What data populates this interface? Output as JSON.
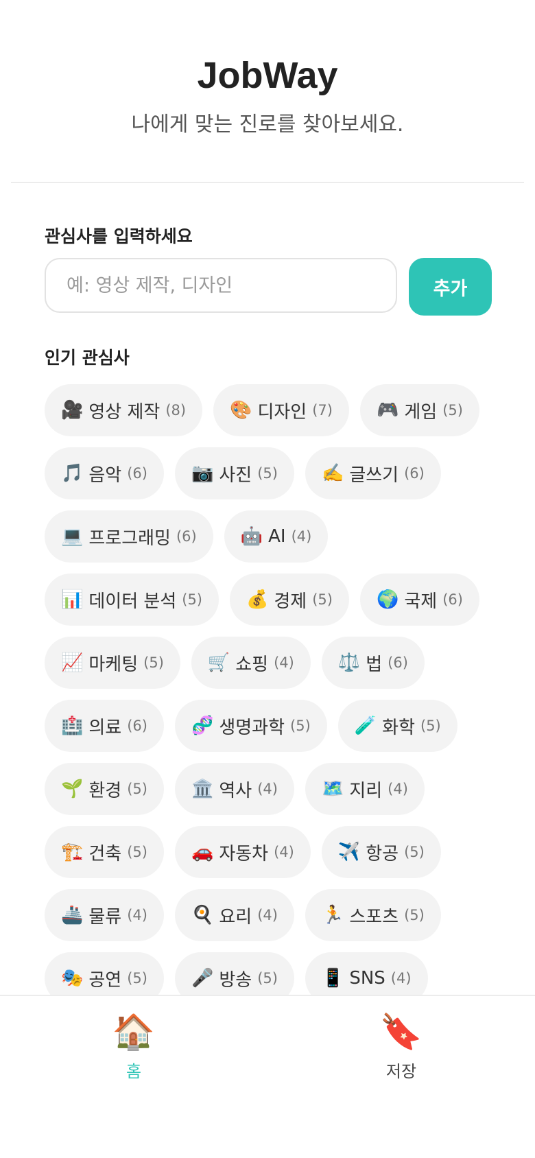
{
  "header": {
    "title": "JobWay",
    "subtitle": "나에게 맞는 진로를 찾아보세요."
  },
  "interest_input": {
    "label": "관심사를 입력하세요",
    "placeholder": "예: 영상 제작, 디자인",
    "value": "",
    "add_label": "추가"
  },
  "popular": {
    "label": "인기 관심사",
    "tags": [
      {
        "icon": "🎥",
        "name": "영상 제작",
        "count": "(8)"
      },
      {
        "icon": "🎨",
        "name": "디자인",
        "count": "(7)"
      },
      {
        "icon": "🎮",
        "name": "게임",
        "count": "(5)"
      },
      {
        "icon": "🎵",
        "name": "음악",
        "count": "(6)"
      },
      {
        "icon": "📷",
        "name": "사진",
        "count": "(5)"
      },
      {
        "icon": "✍️",
        "name": "글쓰기",
        "count": "(6)"
      },
      {
        "icon": "💻",
        "name": "프로그래밍",
        "count": "(6)"
      },
      {
        "icon": "🤖",
        "name": "AI",
        "count": "(4)"
      },
      {
        "icon": "📊",
        "name": "데이터 분석",
        "count": "(5)"
      },
      {
        "icon": "💰",
        "name": "경제",
        "count": "(5)"
      },
      {
        "icon": "🌍",
        "name": "국제",
        "count": "(6)"
      },
      {
        "icon": "📈",
        "name": "마케팅",
        "count": "(5)"
      },
      {
        "icon": "🛒",
        "name": "쇼핑",
        "count": "(4)"
      },
      {
        "icon": "⚖️",
        "name": "법",
        "count": "(6)"
      },
      {
        "icon": "🏥",
        "name": "의료",
        "count": "(6)"
      },
      {
        "icon": "🧬",
        "name": "생명과학",
        "count": "(5)"
      },
      {
        "icon": "🧪",
        "name": "화학",
        "count": "(5)"
      },
      {
        "icon": "🌱",
        "name": "환경",
        "count": "(5)"
      },
      {
        "icon": "🏛️",
        "name": "역사",
        "count": "(4)"
      },
      {
        "icon": "🗺️",
        "name": "지리",
        "count": "(4)"
      },
      {
        "icon": "🏗️",
        "name": "건축",
        "count": "(5)"
      },
      {
        "icon": "🚗",
        "name": "자동차",
        "count": "(4)"
      },
      {
        "icon": "✈️",
        "name": "항공",
        "count": "(5)"
      },
      {
        "icon": "🚢",
        "name": "물류",
        "count": "(4)"
      },
      {
        "icon": "🍳",
        "name": "요리",
        "count": "(4)"
      },
      {
        "icon": "🏃",
        "name": "스포츠",
        "count": "(5)"
      },
      {
        "icon": "🎭",
        "name": "공연",
        "count": "(5)"
      },
      {
        "icon": "🎤",
        "name": "방송",
        "count": "(5)"
      },
      {
        "icon": "📱",
        "name": "SNS",
        "count": "(4)"
      }
    ]
  },
  "bottom_nav": {
    "home": {
      "icon": "🏠",
      "label": "홈",
      "icon_name": "home-icon"
    },
    "saved": {
      "icon": "🔖",
      "label": "저장",
      "icon_name": "bookmark-icon"
    }
  },
  "colors": {
    "accent": "#2ec4b6",
    "tag_bg": "#f3f3f3"
  }
}
